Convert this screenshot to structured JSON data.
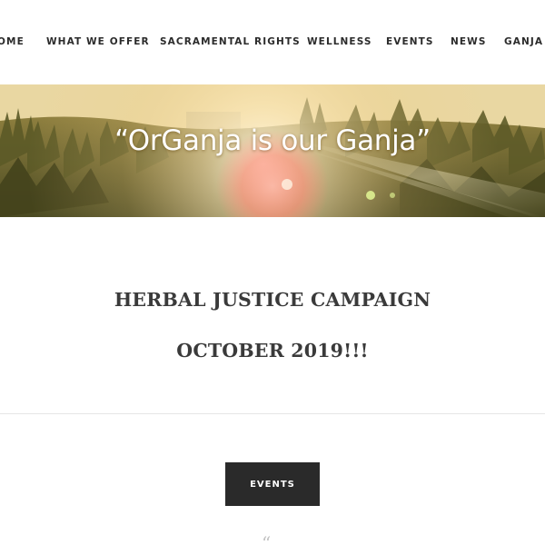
{
  "nav": {
    "items": [
      {
        "label": "HOME",
        "visible_text": "OME"
      },
      {
        "label": "WHAT WE OFFER"
      },
      {
        "label": "SACRAMENTAL RIGHTS"
      },
      {
        "label": "WELLNESS"
      },
      {
        "label": "EVENTS"
      },
      {
        "label": "NEWS"
      },
      {
        "label": "GANJA"
      }
    ]
  },
  "hero": {
    "quote": "“OrGanja is our Ganja”"
  },
  "campaign": {
    "title": "HERBAL JUSTICE CAMPAIGN",
    "date": "OCTOBER 2019!!!"
  },
  "events_button": {
    "label": "EVENTS"
  },
  "testimonial": {
    "quote_mark": "“"
  },
  "colors": {
    "text_dark": "#2b2b2b",
    "heading": "#3a3a3a",
    "button_bg": "#2a2a2a",
    "button_text": "#ffffff",
    "divider": "#e6e6e6"
  }
}
